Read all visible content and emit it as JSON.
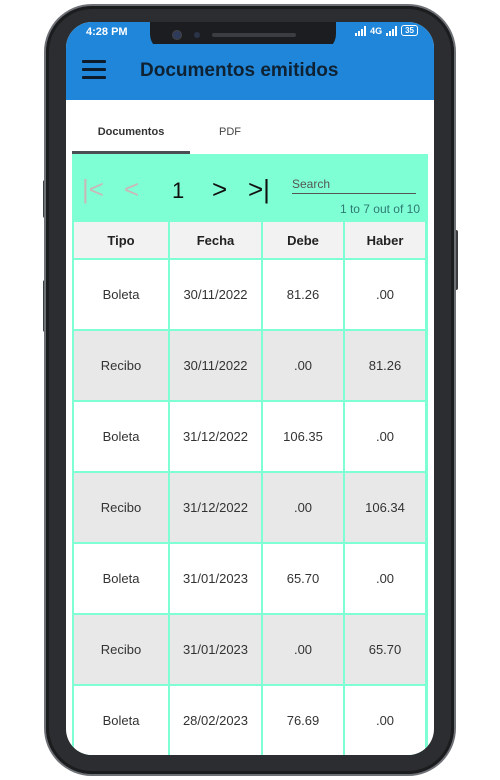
{
  "status": {
    "time": "4:28 PM",
    "signal": "4G",
    "battery": "35"
  },
  "header": {
    "title": "Documentos emitidos"
  },
  "tabs": [
    {
      "label": "Documentos",
      "active": true
    },
    {
      "label": "PDF",
      "active": false
    }
  ],
  "pager": {
    "first": "|<",
    "prev": "<",
    "page": "1",
    "next": ">",
    "last": ">|",
    "search_placeholder": "Search",
    "range": "1 to 7 out of 10"
  },
  "table": {
    "columns": [
      "Tipo",
      "Fecha",
      "Debe",
      "Haber"
    ],
    "rows": [
      [
        "Boleta",
        "30/11/2022",
        "81.26",
        ".00"
      ],
      [
        "Recibo",
        "30/11/2022",
        ".00",
        "81.26"
      ],
      [
        "Boleta",
        "31/12/2022",
        "106.35",
        ".00"
      ],
      [
        "Recibo",
        "31/12/2022",
        ".00",
        "106.34"
      ],
      [
        "Boleta",
        "31/01/2023",
        "65.70",
        ".00"
      ],
      [
        "Recibo",
        "31/01/2023",
        ".00",
        "65.70"
      ],
      [
        "Boleta",
        "28/02/2023",
        "76.69",
        ".00"
      ]
    ]
  },
  "colors": {
    "appbar": "#1f86d9",
    "pager_bg": "#7fffd4"
  }
}
